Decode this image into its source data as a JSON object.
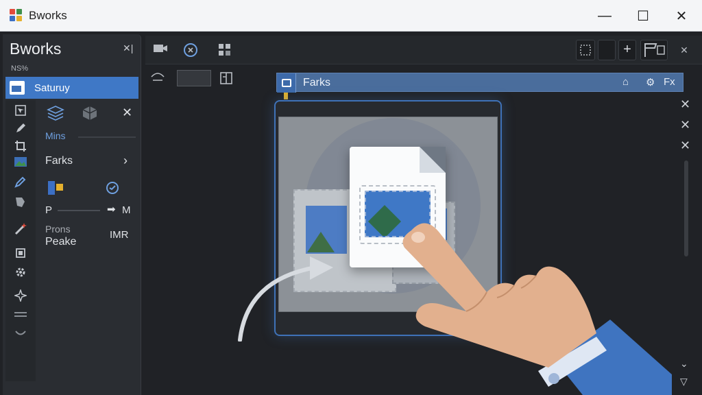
{
  "window": {
    "title": "Bworks",
    "controls": {
      "minimize": "—",
      "maximize": "☐",
      "close": "✕"
    }
  },
  "left_panel": {
    "title": "Bworks",
    "close_label": "✕|",
    "small_label": "NS%",
    "selected_item": "Saturuy",
    "rows": {
      "section_label": "Mins",
      "farks_label": "Farks",
      "p_label": "P",
      "m_label": "M",
      "prons_label": "Prons",
      "peake_label": "Peake",
      "imr_label": "IMR"
    }
  },
  "document_panel": {
    "header_title": "Farks",
    "header_right_label": "Fx"
  },
  "colors": {
    "accent": "#3f78c6",
    "header": "#4a6d9c",
    "panel": "#2a2d32",
    "background": "#202226",
    "skin": "#e2b08e",
    "sleeve": "#3f74c0"
  }
}
